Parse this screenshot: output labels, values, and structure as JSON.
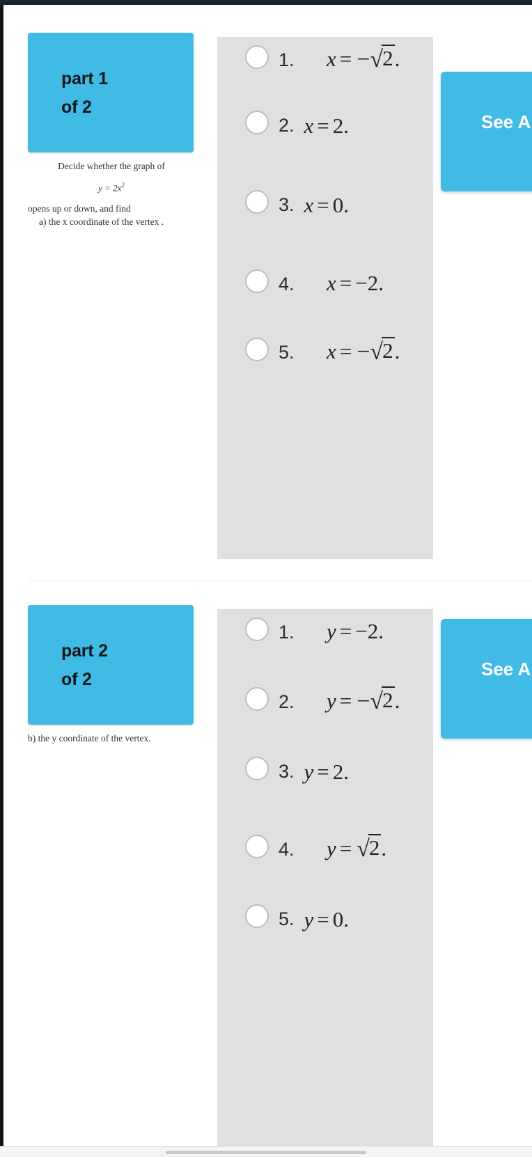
{
  "parts": [
    {
      "badge_line1": "part 1",
      "badge_line2": "of 2",
      "prompt_line1": "Decide whether the graph of",
      "prompt_equation": "y = 2x",
      "prompt_exponent": "2",
      "prompt_line2": "opens up or down, and find",
      "prompt_line3": "a) the x coordinate of the vertex .",
      "action_label": "See Answer",
      "options": [
        {
          "number": "1.",
          "layout": "stacked",
          "var": "x",
          "rel": "=",
          "value": "√2",
          "trailing": ".",
          "has_sqrt": true,
          "negative": false,
          "radicand": "2"
        },
        {
          "number": "2.",
          "layout": "inline",
          "var": "x",
          "rel": "=",
          "value": "2",
          "trailing": ".",
          "has_sqrt": false,
          "negative": false,
          "radicand": ""
        },
        {
          "number": "3.",
          "layout": "inline",
          "var": "x",
          "rel": "=",
          "value": "0",
          "trailing": ".",
          "has_sqrt": false,
          "negative": false,
          "radicand": ""
        },
        {
          "number": "4.",
          "layout": "stacked",
          "var": "x",
          "rel": "=",
          "value": "−2",
          "trailing": ".",
          "has_sqrt": false,
          "negative": true,
          "radicand": ""
        },
        {
          "number": "5.",
          "layout": "stacked",
          "var": "x",
          "rel": "=",
          "value": "−√2",
          "trailing": ".",
          "has_sqrt": true,
          "negative": true,
          "radicand": "2"
        }
      ]
    },
    {
      "badge_line1": "part 2",
      "badge_line2": "of 2",
      "prompt_line1": "b) the y coordinate of the vertex.",
      "prompt_equation": "",
      "prompt_exponent": "",
      "prompt_line2": "",
      "prompt_line3": "",
      "action_label": "See Answer",
      "options": [
        {
          "number": "1.",
          "layout": "stacked",
          "var": "y",
          "rel": "=",
          "value": "−2",
          "trailing": ".",
          "has_sqrt": false,
          "negative": true,
          "radicand": ""
        },
        {
          "number": "2.",
          "layout": "stacked",
          "var": "y",
          "rel": "=",
          "value": "−√2",
          "trailing": ".",
          "has_sqrt": true,
          "negative": true,
          "radicand": "2"
        },
        {
          "number": "3.",
          "layout": "inline",
          "var": "y",
          "rel": "=",
          "value": "2",
          "trailing": ".",
          "has_sqrt": false,
          "negative": false,
          "radicand": ""
        },
        {
          "number": "4.",
          "layout": "stacked",
          "var": "y",
          "rel": "=",
          "value": "√2",
          "trailing": ".",
          "has_sqrt": true,
          "negative": false,
          "radicand": "2"
        },
        {
          "number": "5.",
          "layout": "inline",
          "var": "y",
          "rel": "=",
          "value": "0",
          "trailing": ".",
          "has_sqrt": false,
          "negative": false,
          "radicand": ""
        }
      ]
    }
  ],
  "colors": {
    "accent": "#3fbbe5",
    "panel": "#e0e0e0",
    "page": "#ffffff",
    "text": "#222222"
  }
}
